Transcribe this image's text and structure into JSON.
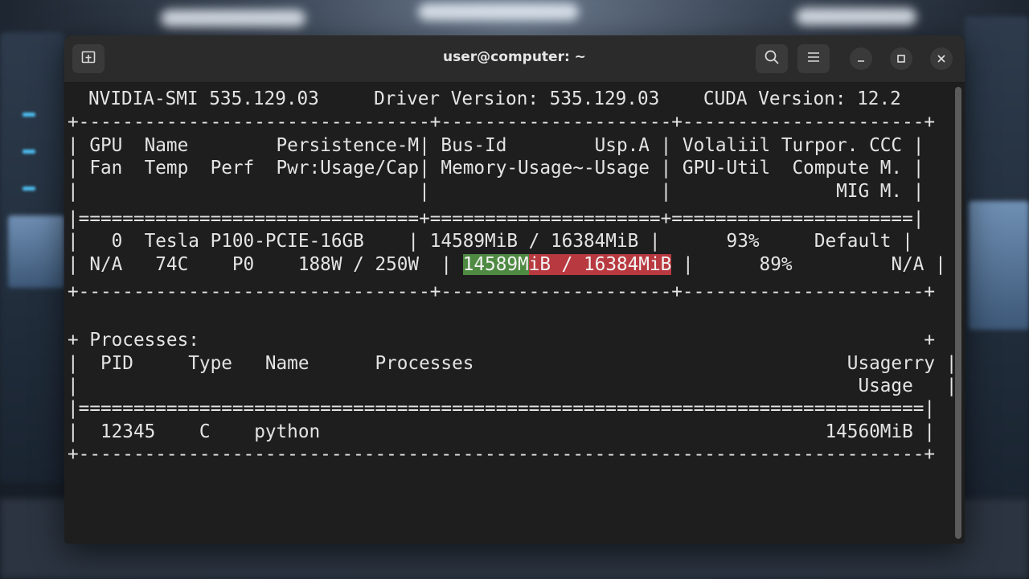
{
  "window": {
    "title": "user@computer: ~"
  },
  "terminal": {
    "header": "NVIDIA-SMI 535.129.03     Driver Version: 535.129.03    CUDA Version: 12.2",
    "sep_top": "+--------------------------------+---------------------+----------------------+",
    "col_row1": "| GPU  Name        Persistence-M| Bus-Id        Usp.A | Volaliil Turpor. CCC |",
    "col_row2": "| Fan  Temp  Perf  Pwr:Usage/Cap| Memory-Usage~-Usage | GPU-Util  Compute M. |",
    "col_row3": "|                               |                     |               MIG M. |",
    "sep_double": "|===============================+=====================+======================|",
    "gpu_row1": "|   0  Tesla P100-PCIE-16GB    | 14589MiB / 16384MiB |      93%     Default |",
    "gpu_row2_prefix": "| N/A   74C    P0    188W / 250W  | ",
    "gpu_row2_mem_green": "14589M",
    "gpu_row2_mem_red": "iB / 16384MiB",
    "gpu_row2_suffix": " |      89%         N/A |",
    "sep_mid": "+--------------------------------+---------------------+----------------------+",
    "proc_header": "+ Processes:                                                                  +",
    "proc_cols1": "|  PID     Type   Name      Processes                                  Usagerry |",
    "proc_cols2": "|                                                                       Usage   |",
    "proc_sep": "|=============================================================================|",
    "proc_row": "|  12345    C    python                                              14560MiB |",
    "sep_bottom": "+-----------------------------------------------------------------------------+"
  },
  "icons": {
    "new_tab": "new-tab-icon",
    "search": "search-icon",
    "menu": "hamburger-menu-icon",
    "minimize": "minimize-icon",
    "maximize": "maximize-icon",
    "close": "close-icon"
  },
  "colors": {
    "terminal_bg": "#1e1e1e",
    "text": "#e4e4e4",
    "highlight_green": "#4f8a43",
    "highlight_red": "#b8393f"
  }
}
